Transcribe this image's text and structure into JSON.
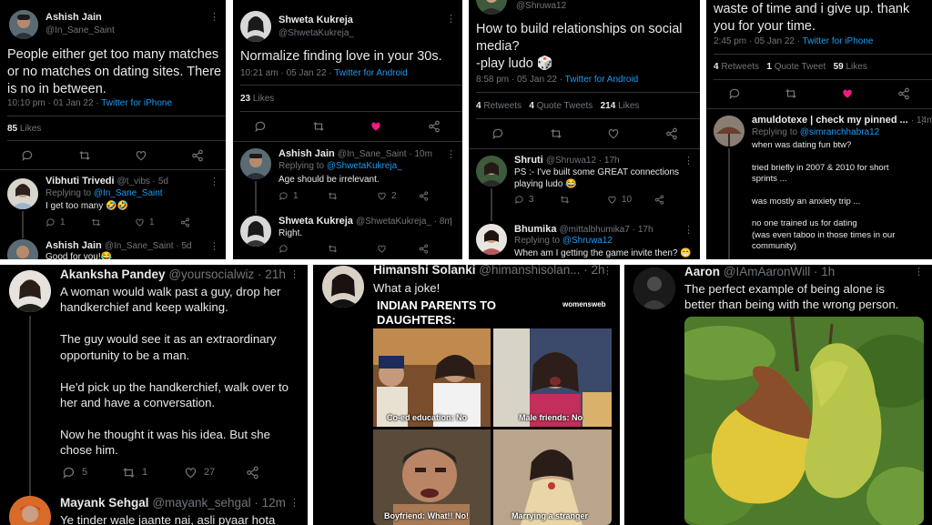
{
  "colors": {
    "bg": "#000000",
    "text": "#e7e9ea",
    "muted": "#71767b",
    "link": "#1d9bf0",
    "like": "#f91880",
    "divider": "#2f3336"
  },
  "p1": {
    "main": {
      "name": "Ashish Jain",
      "handle": "@In_Sane_Saint",
      "text": "People either get too many matches\nor no matches on dating sites. There\nis no in between.",
      "time": "10:10 pm · 01 Jan 22 · ",
      "client": "Twitter for iPhone",
      "likes_count": "85",
      "likes_label": "Likes"
    },
    "reply1": {
      "name": "Vibhuti Trivedi",
      "meta": "@t_vibs · 5d",
      "replying": "Replying to ",
      "replying_to": "@In_Sane_Saint",
      "text": "I get too many 🤣🤣",
      "c_reply": "1",
      "c_rt": "",
      "c_like": "1"
    },
    "reply2": {
      "name": "Ashish Jain",
      "meta": "@In_Sane_Saint · 5d",
      "text": "Good for you!😂"
    }
  },
  "p2": {
    "main": {
      "name": "Shweta Kukreja",
      "handle": "@ShwetaKukreja_",
      "text": "Normalize finding love in your 30s.",
      "time": "10:21 am · 05 Jan 22 · ",
      "client": "Twitter for Android",
      "likes_count": "23",
      "likes_label": "Likes"
    },
    "reply1": {
      "name": "Ashish Jain",
      "meta": "@In_Sane_Saint · 10m",
      "replying": "Replying to ",
      "replying_to": "@ShwetaKukreja_",
      "text": "Age should be irrelevant.",
      "c_reply": "1",
      "c_like": "2"
    },
    "reply2": {
      "name": "Shweta Kukreja",
      "meta": "@ShwetaKukreja_ · 8m",
      "text": "Right."
    }
  },
  "p3": {
    "top_handle": "@Shruwa12",
    "main": {
      "text": "How to build relationships on social\nmedia?\n-play ludo 🎲",
      "time": "8:58 pm · 05 Jan 22 · ",
      "client": "Twitter for Android",
      "retweets_count": "4",
      "retweets_label": "Retweets",
      "quotes_count": "4",
      "quotes_label": "Quote Tweets",
      "likes_count": "214",
      "likes_label": "Likes"
    },
    "reply1": {
      "name": "Shruti",
      "meta": "@Shruwa12 · 17h",
      "text": "PS :- I've built some GREAT connections\nplaying ludo 😂",
      "c_reply": "3",
      "c_like": "10"
    },
    "reply2": {
      "name": "Bhumika",
      "meta": "@mittalbhumika7 · 17h",
      "replying": "Replying to ",
      "replying_to": "@Shruwa12",
      "text": "When am I getting the game invite then? 😁"
    }
  },
  "p4": {
    "main": {
      "text": "waste of time and i give up. thank\nyou for your time.",
      "time": "2:45 pm · 05 Jan 22 · ",
      "client": "Twitter for iPhone",
      "retweets_count": "4",
      "retweets_label": "Retweets",
      "quotes_count": "1",
      "quotes_label": "Quote Tweet",
      "likes_count": "59",
      "likes_label": "Likes"
    },
    "reply1": {
      "name": "amuldotexe | check my pinned ...",
      "meta": "· 14m",
      "replying": "Replying to ",
      "replying_to": "@simranchhabra12",
      "text": "when was dating fun btw?\n\ntried briefly in 2007 & 2010 for short\nsprints ...\n\nwas mostly an anxiety trip ...\n\nno one trained us for dating\n(was even taboo in those times in our\ncommunity)"
    }
  },
  "p5": {
    "main": {
      "name": "Akanksha Pandey",
      "meta": "@yoursocialwiz · 21h",
      "text": "A woman would walk past a guy, drop her\nhandkerchief and keep walking.\n\nThe guy would see it as an extraordinary\nopportunity to be a man.\n\nHe'd pick up the handkerchief, walk over to\nher and have a conversation.\n\nNow he thought it was his idea. But she\nchose him.",
      "c_reply": "5",
      "c_rt": "1",
      "c_like": "27"
    },
    "reply1": {
      "name": "Mayank Sehgal",
      "meta": "@mayank_sehgal · 12m",
      "text": "Ye tinder wale jaante nai, asli pyaar hota"
    }
  },
  "p6": {
    "main": {
      "name": "Himanshi Solanki",
      "meta": "@himanshisolan... · 2h",
      "text": "What a joke!"
    },
    "meme": {
      "title": "INDIAN PARENTS TO\nDAUGHTERS:",
      "brand": "womensweb",
      "cap1": "Co-ed education: No",
      "cap2": "Male friends: No",
      "cap3": "Boyfriend: What!! No!",
      "cap4": "Marrying a stranger"
    }
  },
  "p7": {
    "main": {
      "name": "Aaron",
      "meta": "@IAmAaronWill · 1h",
      "text": "The perfect example of being alone is\nbetter than being with the wrong person."
    }
  }
}
